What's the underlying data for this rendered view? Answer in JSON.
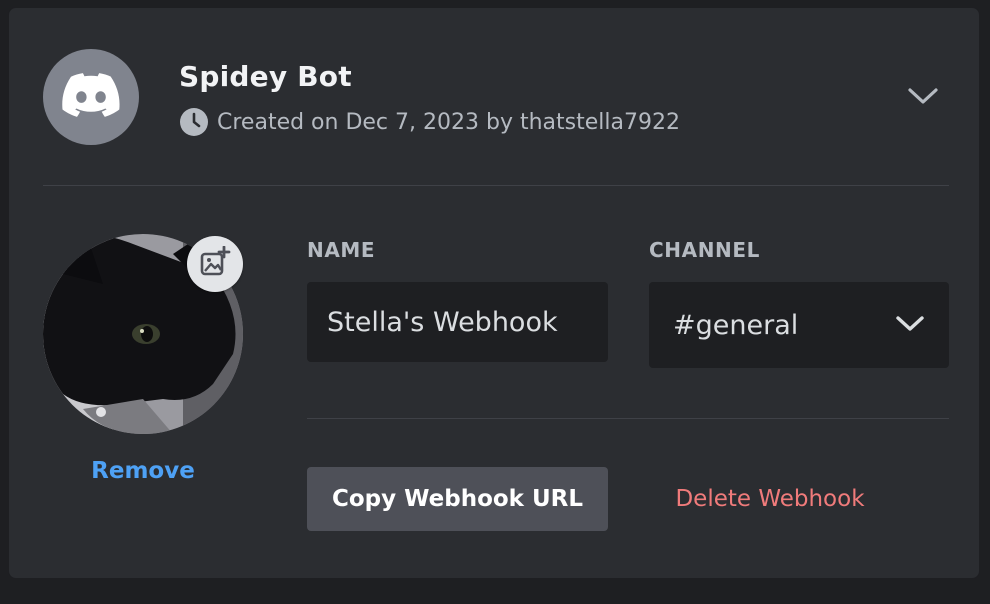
{
  "webhook": {
    "bot_name": "Spidey Bot",
    "created_text": "Created on Dec 7, 2023 by thatstella7922",
    "icons": {
      "bot_avatar": "discord-logo-icon",
      "clock": "clock-icon",
      "expand": "chevron-down-icon",
      "upload": "add-image-icon",
      "channel_dropdown": "chevron-down-icon"
    }
  },
  "avatar": {
    "remove_label": "Remove"
  },
  "form": {
    "name_label": "NAME",
    "name_value": "Stella's Webhook",
    "channel_label": "CHANNEL",
    "channel_value": "#general"
  },
  "actions": {
    "copy_label": "Copy Webhook URL",
    "delete_label": "Delete Webhook"
  },
  "colors": {
    "panel": "#2b2d31",
    "input": "#1e1f22",
    "link_blue": "#4ea1f5",
    "danger": "#f07b7b",
    "secondary_button": "#4e5058"
  }
}
